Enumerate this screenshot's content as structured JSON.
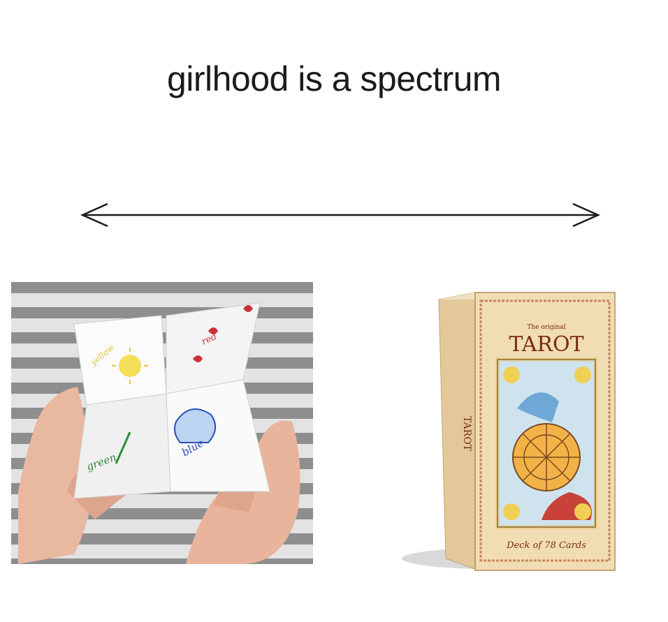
{
  "title": "girlhood is a spectrum",
  "fortune_teller": {
    "flap_words": [
      "yellow",
      "red",
      "green",
      "blue"
    ]
  },
  "tarot_box": {
    "subtitle": "The original",
    "title": "TAROT",
    "spine": "TAROT",
    "footer": "Deck of 78 Cards"
  },
  "colors": {
    "text": "#1b1b1b",
    "stripe_gray": "#8e8e8e",
    "stripe_light": "#e3e3e3",
    "box_cream": "#f1ddb4",
    "box_brown": "#7a2a12"
  }
}
